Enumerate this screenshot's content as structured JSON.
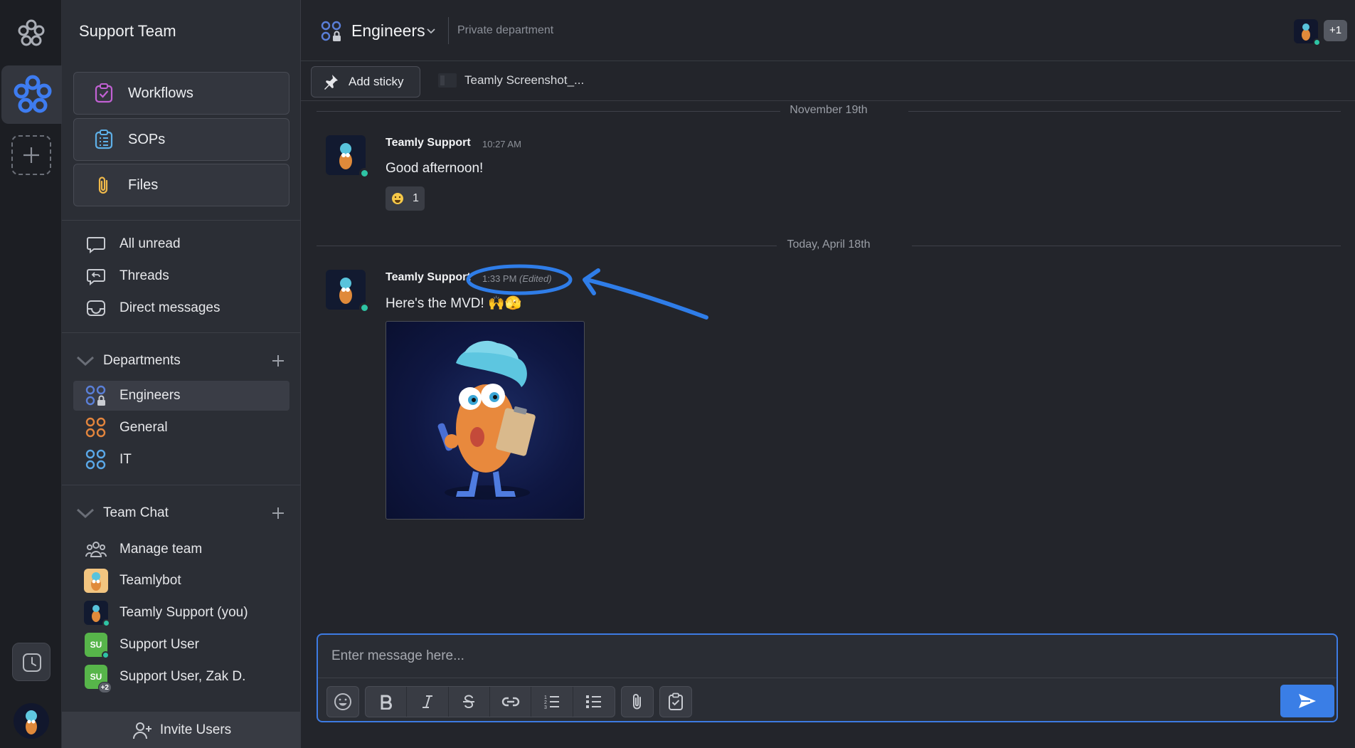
{
  "sidebar": {
    "team_name": "Support Team",
    "features": [
      {
        "label": "Workflows",
        "icon": "workflow-icon"
      },
      {
        "label": "SOPs",
        "icon": "clipboard-list-icon"
      },
      {
        "label": "Files",
        "icon": "paperclip-icon"
      }
    ],
    "nav": [
      {
        "label": "All unread",
        "icon": "chat-bubble-icon"
      },
      {
        "label": "Threads",
        "icon": "thread-reply-icon"
      },
      {
        "label": "Direct messages",
        "icon": "inbox-icon"
      }
    ],
    "departments": {
      "label": "Departments",
      "items": [
        {
          "label": "Engineers",
          "icon": "department-lock-icon",
          "active": true
        },
        {
          "label": "General",
          "icon": "department-icon"
        },
        {
          "label": "IT",
          "icon": "department-icon"
        }
      ]
    },
    "team_chat": {
      "label": "Team Chat",
      "items": [
        {
          "label": "Manage team",
          "icon": "team-icon"
        },
        {
          "label": "Teamlybot",
          "avatar": "bot-avatar"
        },
        {
          "label": "Teamly Support (you)",
          "avatar": "mascot-avatar"
        },
        {
          "label": "Support User",
          "initials": "SU"
        },
        {
          "label": "Support User, Zak D.",
          "initials": "SU",
          "badge": "+2"
        }
      ]
    },
    "invite_label": "Invite Users"
  },
  "header": {
    "channel_name": "Engineers",
    "description": "Private department",
    "member_overflow": "+1"
  },
  "sticky_bar": {
    "add_sticky_label": "Add sticky",
    "file_label": "Teamly Screenshot_..."
  },
  "messages": {
    "date1": "November 19th",
    "date2": "Today, April 18th",
    "m1": {
      "author": "Teamly Support",
      "time": "10:27 AM",
      "text": "Good afternoon!",
      "reaction_count": "1"
    },
    "m2": {
      "author": "Teamly Support",
      "time": "1:33 PM",
      "edited": "(Edited)",
      "text": "Here's the MVD! 🙌🫣"
    }
  },
  "composer": {
    "placeholder": "Enter message here..."
  },
  "colors": {
    "accent": "#3a7ee6",
    "online": "#2ec4a5",
    "annotation": "#2f7de8",
    "su_avatar": "#57b54a"
  }
}
